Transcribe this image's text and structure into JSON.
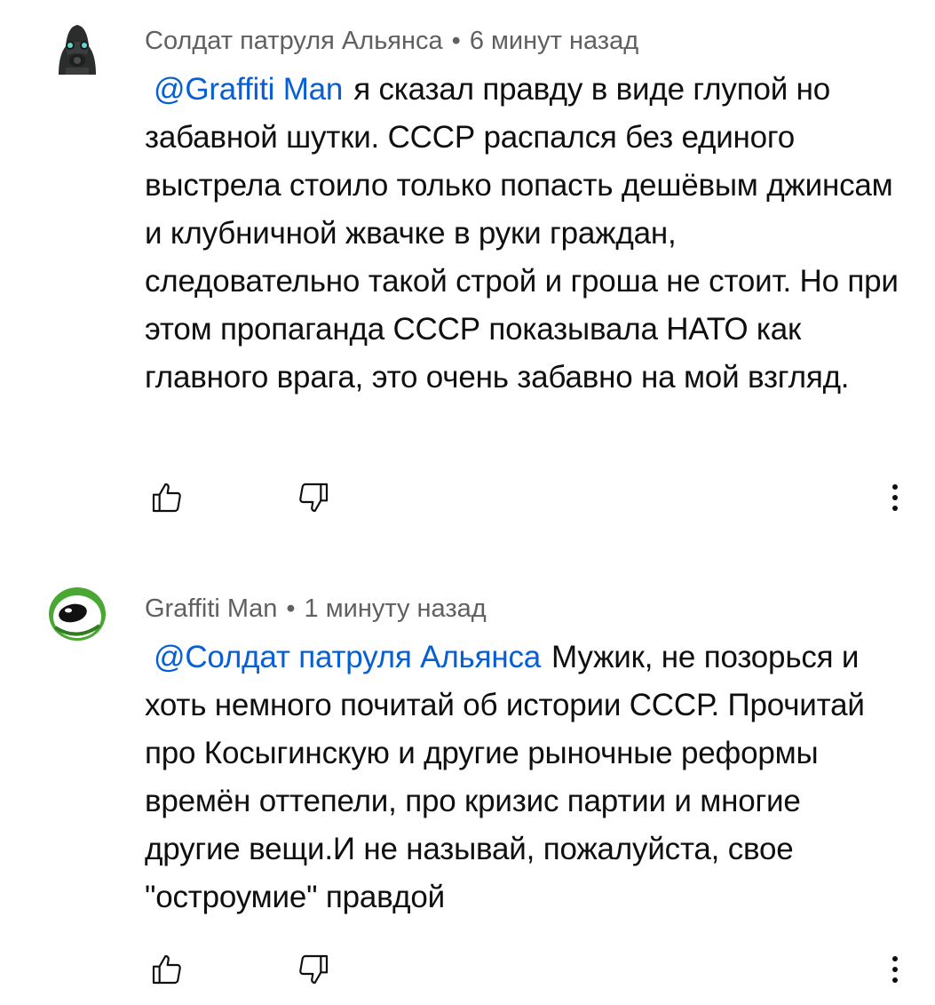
{
  "comments": [
    {
      "author": "Солдат патруля Альянса",
      "separator": "•",
      "time": "6 минут назад",
      "avatar_icon": "combine-soldier-avatar",
      "mention": "@Graffiti Man",
      "text": "я сказал правду в виде глупой но забавной шутки. СССР распался без единого выстрела стоило только попасть дешёвым джинсам и клубничной жвачке в руки граждан, следовательно такой строй и гроша не стоит. Но при этом пропаганда СССР показывала НАТО как главного врага, это очень забавно на мой взгляд."
    },
    {
      "author": "Graffiti Man",
      "separator": "•",
      "time": "1 минуту назад",
      "avatar_icon": "green-eye-avatar",
      "mention": "@Солдат патруля Альянса",
      "text": "Мужик, не позорься и хоть немного почитай об истории СССР. Прочитай про Косыгинскую и другие рыночные реформы времён оттепели, про кризис партии и многие другие вещи.И не называй, пожалуйста, свое \"остроумие\" правдой"
    }
  ],
  "icons": {
    "like": "thumbs-up-icon",
    "dislike": "thumbs-down-icon",
    "more": "more-vert-icon"
  },
  "colors": {
    "mention": "#065fd4",
    "meta": "#606060",
    "text": "#0f0f0f"
  }
}
